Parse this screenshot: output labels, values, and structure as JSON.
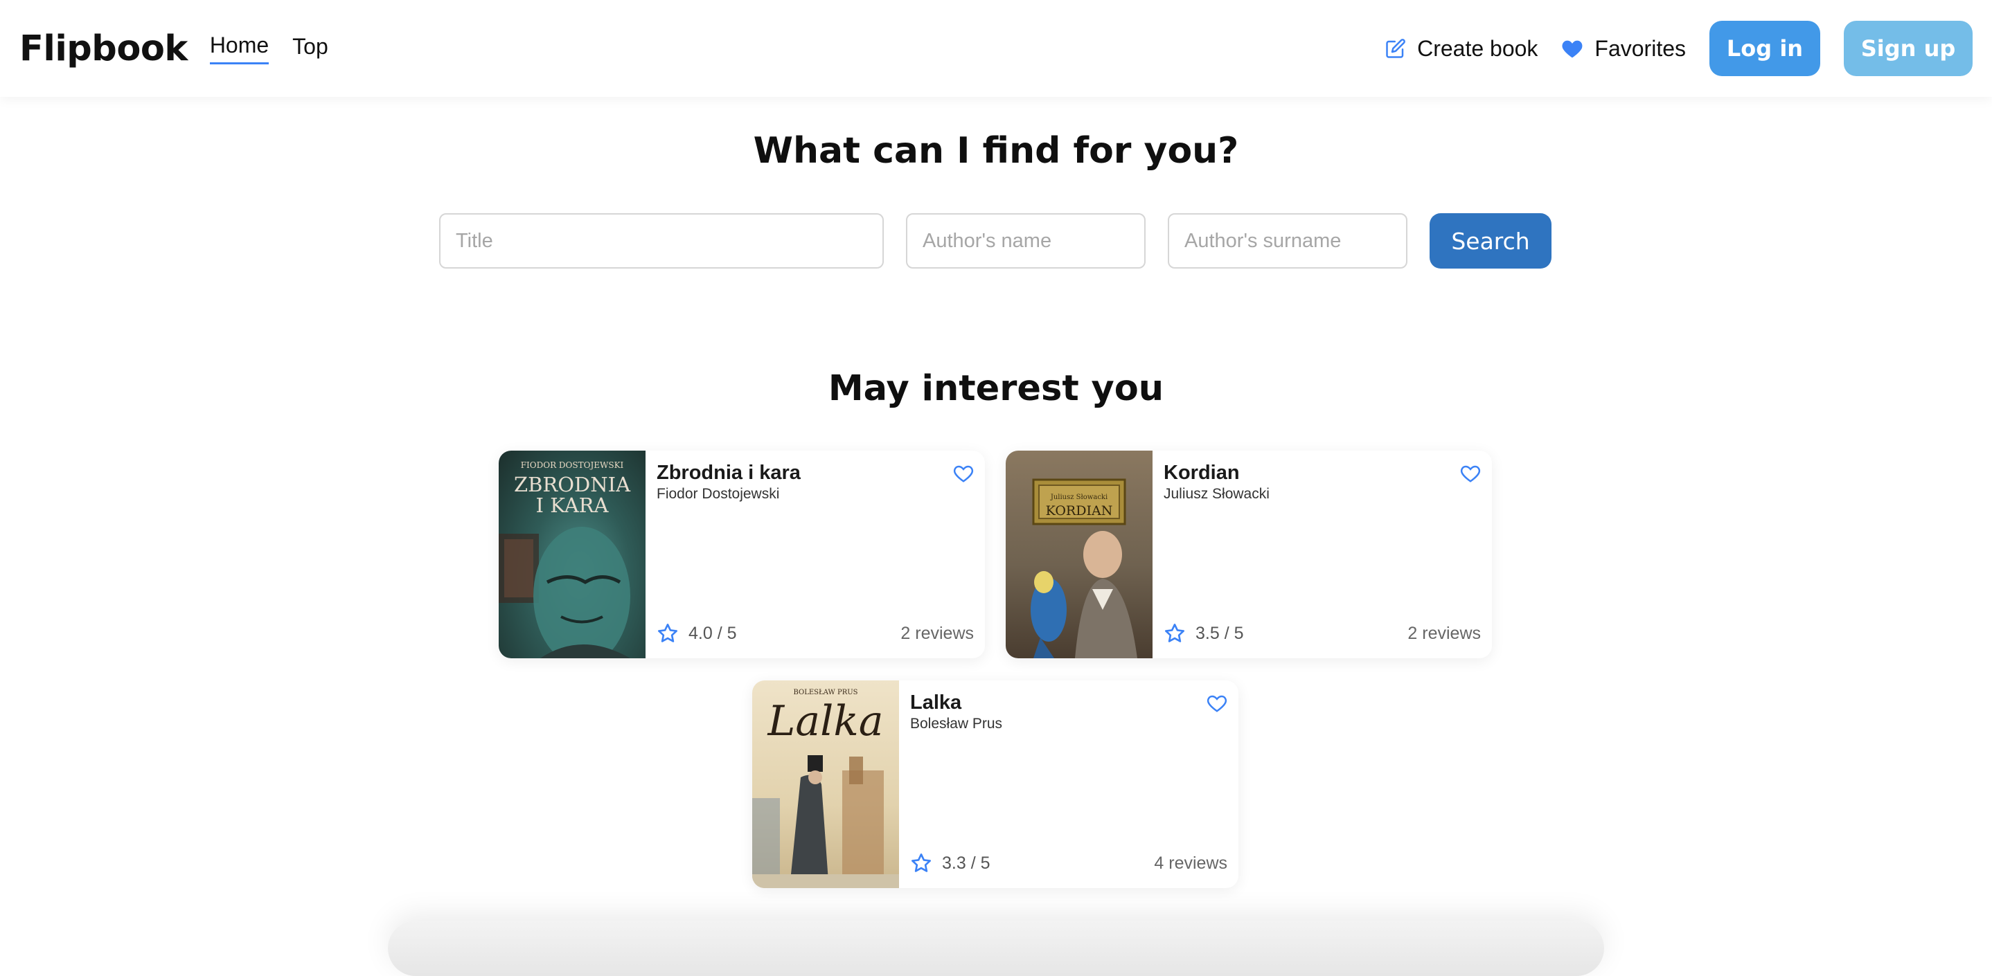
{
  "header": {
    "logo": "Flipbook",
    "nav": [
      {
        "label": "Home"
      },
      {
        "label": "Top"
      }
    ],
    "create_book": "Create book",
    "favorites": "Favorites",
    "login": "Log in",
    "signup": "Sign up"
  },
  "search": {
    "headline": "What can I find for you?",
    "title_placeholder": "Title",
    "name_placeholder": "Author's name",
    "surname_placeholder": "Author's surname",
    "button": "Search"
  },
  "recommendations": {
    "title": "May interest you",
    "books": [
      {
        "title": "Zbrodnia i kara",
        "author": "Fiodor Dostojewski",
        "rating": "4.0 / 5",
        "reviews": "2 reviews",
        "cover_author": "FIODOR DOSTOJEWSKI",
        "cover_title_1": "ZBRODNIA",
        "cover_title_2": "I KARA"
      },
      {
        "title": "Kordian",
        "author": "Juliusz Słowacki",
        "rating": "3.5 / 5",
        "reviews": "2 reviews",
        "cover_author": "Juliusz Słowacki",
        "cover_title_1": "KORDIAN"
      },
      {
        "title": "Lalka",
        "author": "Bolesław Prus",
        "rating": "3.3 / 5",
        "reviews": "4 reviews",
        "cover_author": "BOLESŁAW PRUS",
        "cover_title_1": "Lalka"
      }
    ]
  },
  "colors": {
    "accent": "#4299e8",
    "accent_dark": "#2f74c0",
    "signup": "#74bde8"
  }
}
